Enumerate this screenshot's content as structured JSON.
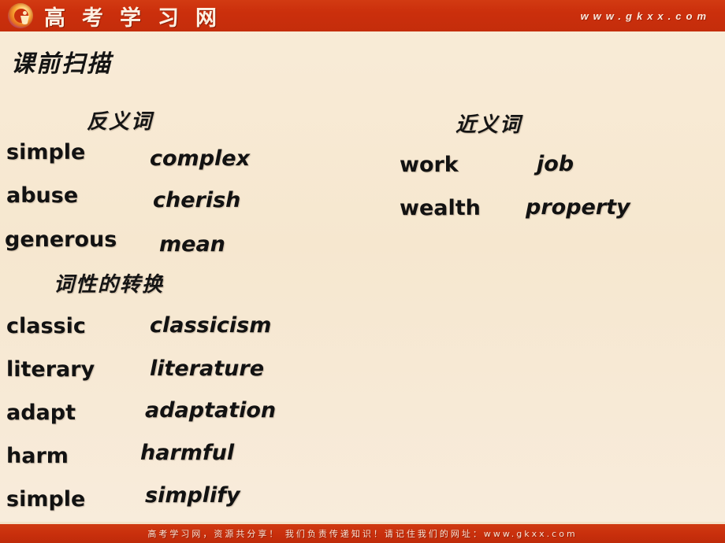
{
  "header": {
    "logo_name": "gkxx-logo",
    "brand_chars": [
      "高",
      "考",
      "学",
      "习",
      "网"
    ],
    "url": "www.gkxx.com",
    "bar_color": "#cb300d"
  },
  "slide": {
    "title": "课前扫描",
    "background_color": "#f6e7cf"
  },
  "sections": {
    "antonyms": {
      "heading": "反义词",
      "pairs": [
        {
          "base": "simple",
          "derived": "complex"
        },
        {
          "base": "abuse",
          "derived": "cherish"
        },
        {
          "base": "generous",
          "derived": "mean"
        }
      ]
    },
    "synonyms": {
      "heading": "近义词",
      "pairs": [
        {
          "base": "work",
          "derived": "job"
        },
        {
          "base": "wealth",
          "derived": "property"
        }
      ]
    },
    "conversion": {
      "heading": "词性的转换",
      "pairs": [
        {
          "base": "classic",
          "derived": "classicism"
        },
        {
          "base": "literary",
          "derived": "literature"
        },
        {
          "base": "adapt",
          "derived": "adaptation"
        },
        {
          "base": "harm",
          "derived": "harmful"
        },
        {
          "base": "simple",
          "derived": "simplify"
        }
      ]
    }
  },
  "footer": {
    "text": "高考学习网，资源共分享！  我们负责传递知识！请记住我们的网址：www.gkxx.com",
    "bar_color": "#c82f0c"
  }
}
